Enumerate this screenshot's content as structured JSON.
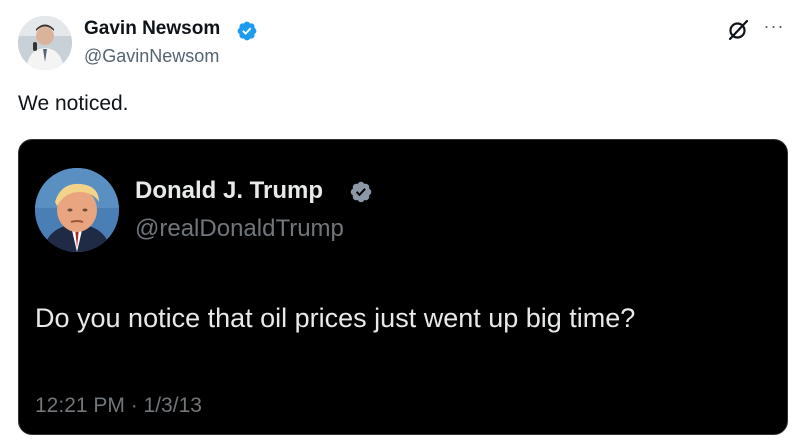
{
  "post": {
    "author": {
      "name": "Gavin Newsom",
      "handle": "@GavinNewsom",
      "verified": true
    },
    "text": "We noticed.",
    "actions": {
      "grok_icon": "grok-icon",
      "more_icon": "more-icon",
      "more_glyph": "···"
    }
  },
  "quoted_post": {
    "author": {
      "name": "Donald J. Trump",
      "handle": "@realDonaldTrump",
      "verified": true
    },
    "text": "Do you notice that oil prices just went up big time?",
    "timestamp": "12:21 PM · 1/3/13"
  },
  "colors": {
    "verified_blue": "#1d9bf0",
    "legacy_verified_gray": "#8b98a5",
    "embed_background": "#000000"
  }
}
